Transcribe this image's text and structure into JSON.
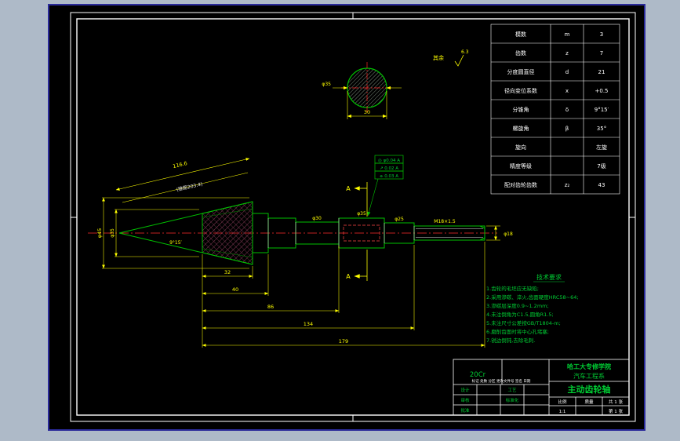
{
  "colors": {
    "bg": "#aebac8",
    "canvas": "#000000",
    "frame": "#ffffff",
    "entity_green": "#00c000",
    "dim_yellow": "#ffff00",
    "center_red": "#ff2a2a",
    "hatch_red": "#c2567a"
  },
  "param_table": {
    "rows": [
      {
        "name": "模数",
        "sym": "m",
        "val": "3"
      },
      {
        "name": "齿数",
        "sym": "z",
        "val": "7"
      },
      {
        "name": "分度圆直径",
        "sym": "d",
        "val": "21"
      },
      {
        "name": "径向变位系数",
        "sym": "x",
        "val": "+0.5"
      },
      {
        "name": "分锥角",
        "sym": "δ",
        "val": "9°15′"
      },
      {
        "name": "螺旋角",
        "sym": "β",
        "val": "35°"
      },
      {
        "name": "旋向",
        "sym": "",
        "val": "左旋"
      },
      {
        "name": "精度等级",
        "sym": "",
        "val": "7级"
      },
      {
        "name": "配对齿轮齿数",
        "sym": "z₂",
        "val": "43"
      }
    ]
  },
  "tech_req": {
    "title": "技术要求",
    "lines": [
      "1.齿轮的毛坯应无缺陷;",
      "2.采用渗碳、淬火,齿面硬度HRC58~64;",
      "3.渗碳层深度0.9~1.2mm;",
      "4.未注倒角为C1.5,圆角R1.5;",
      "5.未注尺寸公差按GB/T1804-m;",
      "6.磨削齿面时将中心孔堵塞;",
      "7.锐边倒钝,去除毛刺."
    ]
  },
  "title_block": {
    "school": "哈工大专修学院",
    "dept": "汽车工程系",
    "part": "主动齿轮轴",
    "material": "20Cr",
    "labels": {
      "revision": "标记 处数 分区 更改文件号 签名 日期",
      "design": "设计",
      "check": "审核",
      "approve": "批准",
      "process": "工艺",
      "standard": "标准化",
      "scale": "比例",
      "scale_val": "1:1",
      "weight": "质量",
      "sheet_total": "共 1 张",
      "sheet_no": "第 1 张"
    }
  },
  "dims": {
    "cone_dist": "116.6",
    "cone_note": "(锥距203.4)",
    "cone_angle": "9°15′",
    "left_outer": "φ45",
    "left_inner": "φ35",
    "sec_dia": "φ35",
    "sec_width": "30",
    "bottom": [
      "32",
      "40",
      "86",
      "134",
      "179"
    ],
    "dia_d": "φ30",
    "dia_e": "φ35",
    "dia_f": "φ25",
    "thread": "M18×1.5",
    "right_end": "φ18"
  },
  "section": {
    "label": "A"
  },
  "surface": {
    "rest": "其余",
    "ra": "6.3"
  },
  "tol_frames": [
    "◎ φ0.04 A",
    "↗ 0.02 A",
    "⌯ 0.03 A"
  ]
}
